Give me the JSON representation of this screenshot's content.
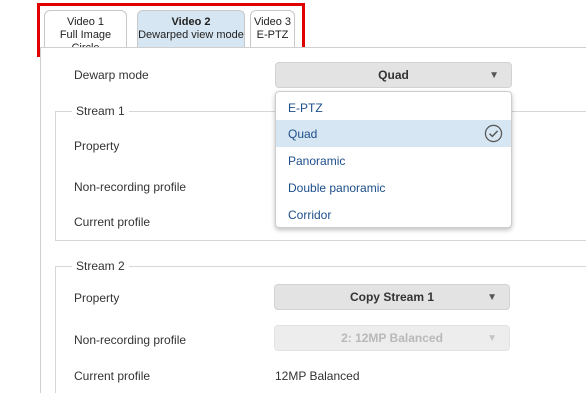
{
  "tabs": [
    {
      "line1": "Video 1",
      "line2": "Full Image Circle"
    },
    {
      "line1": "Video 2",
      "line2": "Dewarped view mode"
    },
    {
      "line1": "Video 3",
      "line2": "E-PTZ"
    }
  ],
  "dewarp": {
    "label": "Dewarp mode",
    "value": "Quad"
  },
  "dropdown": {
    "options": [
      "E-PTZ",
      "Quad",
      "Panoramic",
      "Double panoramic",
      "Corridor"
    ],
    "selected": "Quad"
  },
  "stream1": {
    "legend": "Stream 1",
    "property_label": "Property",
    "nonrec_label": "Non-recording profile",
    "current_label": "Current profile"
  },
  "stream2": {
    "legend": "Stream 2",
    "property_label": "Property",
    "property_value": "Copy Stream 1",
    "nonrec_label": "Non-recording profile",
    "nonrec_value": "2: 12MP Balanced",
    "current_label": "Current profile",
    "current_value": "12MP Balanced"
  }
}
